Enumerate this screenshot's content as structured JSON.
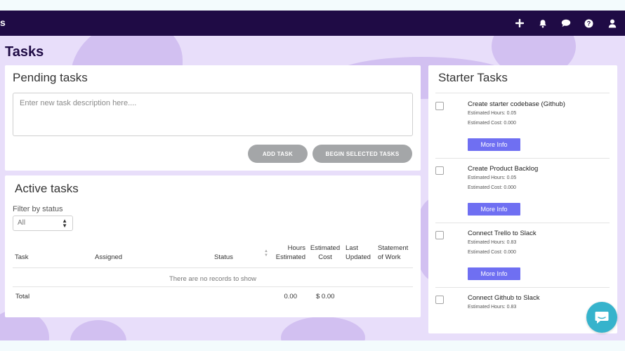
{
  "app": {
    "brand_fragment": "s"
  },
  "page": {
    "title": "Tasks"
  },
  "topbar": {
    "icons": [
      "plus-icon",
      "bell-icon",
      "chat-icon",
      "help-icon",
      "user-icon"
    ],
    "bg_color": "#1f0b45"
  },
  "pending": {
    "title": "Pending tasks",
    "input_placeholder": "Enter new task description here....",
    "add_task_label": "ADD TASK",
    "begin_label": "BEGIN SELECTED TASKS"
  },
  "active": {
    "title": "Active tasks",
    "filter_label": "Filter by status",
    "filter_value": "All",
    "columns": {
      "task": "Task",
      "assigned": "Assigned",
      "status": "Status",
      "hours_1": "Hours",
      "hours_2": "Estimated",
      "cost_1": "Estimated",
      "cost_2": "Cost",
      "last_1": "Last",
      "last_2": "Updated",
      "sow_1": "Statement",
      "sow_2": "of Work"
    },
    "empty_message": "There are no records to show",
    "total_label": "Total",
    "total_hours": "0.00",
    "total_cost": "$ 0.00"
  },
  "starter": {
    "title": "Starter Tasks",
    "more_label": "More Info",
    "items": [
      {
        "name": "Create starter codebase (Github)",
        "hours": "Estimated Hours: 0.05",
        "cost": "Estimated Cost: 0.000"
      },
      {
        "name": "Create Product Backlog",
        "hours": "Estimated Hours: 0.05",
        "cost": "Estimated Cost: 0.000"
      },
      {
        "name": "Connect Trello to Slack",
        "hours": "Estimated Hours: 0.83",
        "cost": "Estimated Cost: 0.000"
      },
      {
        "name": "Connect Github to Slack",
        "hours": "Estimated Hours: 0.83",
        "cost": ""
      }
    ]
  },
  "colors": {
    "accent": "#6f6ff2",
    "chat": "#36b3cc",
    "background": "#e8defa"
  }
}
